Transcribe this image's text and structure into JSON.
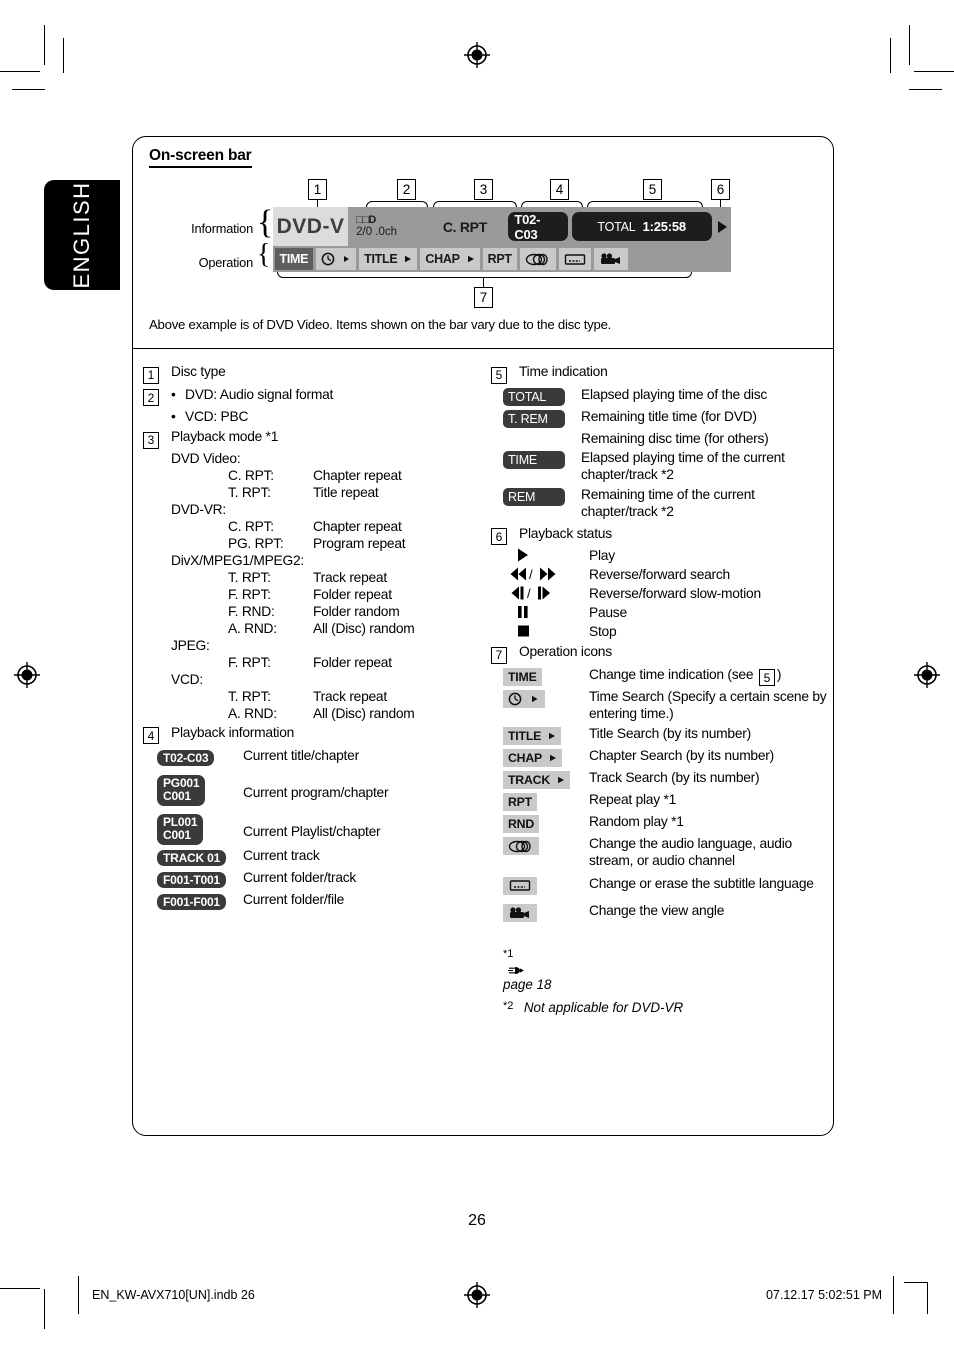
{
  "language_tab": "ENGLISH",
  "panel": {
    "title": "On-screen bar",
    "note": "Above example is of DVD Video. Items shown on the bar vary due to the disc type.",
    "row_labels": {
      "information": "Information",
      "operation": "Operation"
    },
    "callouts": [
      "1",
      "2",
      "3",
      "4",
      "5",
      "6",
      "7"
    ]
  },
  "osd_bar": {
    "disc_type": "DVD-V",
    "audio_format_line1": "□□D",
    "audio_format_line2": "2/0 .0ch",
    "playback_mode": "C. RPT",
    "title_chapter": "T02-C03",
    "time_label": "TOTAL",
    "time_value": "1:25:58",
    "operation_buttons": [
      "TIME",
      "clock-arrow-icon",
      "TITLE",
      "CHAP",
      "RPT",
      "audio-icon",
      "subtitle-icon",
      "angle-icon"
    ],
    "button_labels": {
      "time": "TIME",
      "title": "TITLE",
      "chap": "CHAP",
      "rpt": "RPT"
    }
  },
  "left_column": {
    "item1": {
      "num": "1",
      "label": "Disc type"
    },
    "item2": {
      "num": "2",
      "bullets": [
        "DVD: Audio signal format",
        "VCD: PBC"
      ]
    },
    "item3": {
      "num": "3",
      "label": "Playback mode *1",
      "groups": [
        {
          "heading": "DVD Video:",
          "rows": [
            {
              "k": "C. RPT:",
              "v": "Chapter repeat"
            },
            {
              "k": "T. RPT:",
              "v": "Title repeat"
            }
          ]
        },
        {
          "heading": "DVD-VR:",
          "rows": [
            {
              "k": "C. RPT:",
              "v": "Chapter repeat"
            },
            {
              "k": "PG. RPT:",
              "v": "Program repeat"
            }
          ]
        },
        {
          "heading": "DivX/MPEG1/MPEG2:",
          "rows": [
            {
              "k": "T. RPT:",
              "v": "Track repeat"
            },
            {
              "k": "F. RPT:",
              "v": "Folder repeat"
            },
            {
              "k": "F. RND:",
              "v": "Folder random"
            },
            {
              "k": "A. RND:",
              "v": "All (Disc) random"
            }
          ]
        },
        {
          "heading": "JPEG:",
          "rows": [
            {
              "k": "F. RPT:",
              "v": "Folder repeat"
            }
          ]
        },
        {
          "heading": "VCD:",
          "rows": [
            {
              "k": "T. RPT:",
              "v": "Track repeat"
            },
            {
              "k": "A. RND:",
              "v": "All (Disc) random"
            }
          ]
        }
      ]
    },
    "item4": {
      "num": "4",
      "label": "Playback information",
      "rows": [
        {
          "badge": "T02-C03",
          "badge2": "",
          "desc": "Current title/chapter"
        },
        {
          "badge": "PG001",
          "badge2": "C001",
          "desc": "Current program/chapter"
        },
        {
          "badge": "PL001",
          "badge2": "C001",
          "desc": "Current Playlist/chapter"
        },
        {
          "badge": "TRACK 01",
          "badge2": "",
          "desc": "Current track"
        },
        {
          "badge": "F001-T001",
          "badge2": "",
          "desc": "Current folder/track"
        },
        {
          "badge": "F001-F001",
          "badge2": "",
          "desc": "Current folder/file"
        }
      ]
    }
  },
  "right_column": {
    "item5": {
      "num": "5",
      "label": "Time indication",
      "rows": [
        {
          "badge": "TOTAL",
          "desc": "Elapsed playing time of the disc"
        },
        {
          "badge": "T. REM",
          "desc": "Remaining title time (for DVD)"
        },
        {
          "badge": "",
          "desc": "Remaining disc time (for others)"
        },
        {
          "badge": "TIME",
          "desc": "Elapsed playing time of the current chapter/track *2"
        },
        {
          "badge": "REM",
          "desc": "Remaining time of the current chapter/track *2"
        }
      ]
    },
    "item6": {
      "num": "6",
      "label": "Playback status",
      "rows": [
        {
          "icon": "play-icon",
          "desc": "Play"
        },
        {
          "icon": "reverse-forward-search-icon",
          "desc": "Reverse/forward search"
        },
        {
          "icon": "reverse-forward-slow-icon",
          "desc": "Reverse/forward slow-motion"
        },
        {
          "icon": "pause-icon",
          "desc": "Pause"
        },
        {
          "icon": "stop-icon",
          "desc": "Stop"
        }
      ]
    },
    "item7": {
      "num": "7",
      "label": "Operation icons",
      "rows": [
        {
          "chip": "TIME",
          "desc_pre": "Change time indication (see",
          "desc_num": "5",
          "desc_post": ")"
        },
        {
          "chip": "clock-arrow-icon",
          "desc": "Time Search (Specify a certain scene by entering time.)"
        },
        {
          "chip": "TITLE",
          "arrow": true,
          "desc": "Title Search (by its number)"
        },
        {
          "chip": "CHAP",
          "arrow": true,
          "desc": "Chapter Search (by its number)"
        },
        {
          "chip": "TRACK",
          "arrow": true,
          "desc": "Track Search (by its number)"
        },
        {
          "chip": "RPT",
          "desc": "Repeat play *1"
        },
        {
          "chip": "RND",
          "desc": "Random play *1"
        },
        {
          "chip": "audio-icon",
          "desc": "Change the audio language, audio stream, or audio channel"
        },
        {
          "chip": "subtitle-icon",
          "desc": "Change or erase the subtitle language"
        },
        {
          "chip": "angle-icon",
          "desc": "Change the view angle"
        }
      ]
    }
  },
  "footnotes": [
    {
      "mark": "*1",
      "text": "page 18",
      "has_hand": true
    },
    {
      "mark": "*2",
      "text": "Not applicable for DVD-VR",
      "has_hand": false
    }
  ],
  "page_number": "26",
  "footer": {
    "left": "EN_KW-AVX710[UN].indb   26",
    "right": "07.12.17   5:02:51 PM"
  }
}
